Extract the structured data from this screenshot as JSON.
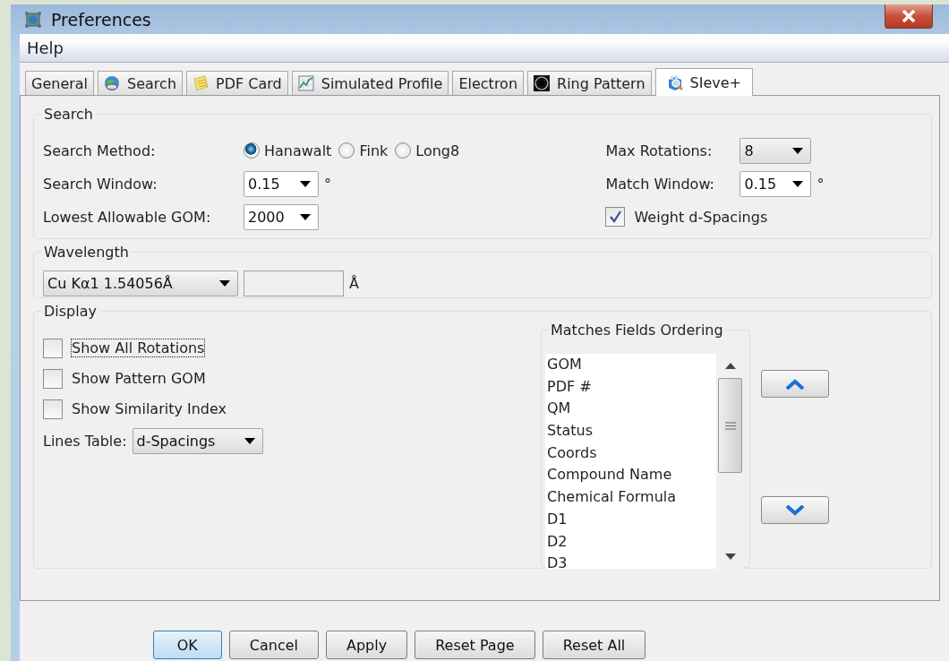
{
  "window": {
    "title": "Preferences"
  },
  "menu": [
    {
      "label": "Help"
    }
  ],
  "tabs": [
    {
      "label": "General",
      "selected": false
    },
    {
      "label": "Search",
      "selected": false
    },
    {
      "label": "PDF Card",
      "selected": false
    },
    {
      "label": "Simulated Profile",
      "selected": false
    },
    {
      "label": "Electron",
      "selected": false
    },
    {
      "label": "Ring Pattern",
      "selected": false
    },
    {
      "label": "SIeve+",
      "selected": true
    }
  ],
  "search": {
    "title": "Search",
    "method": {
      "label": "Search Method:",
      "options": [
        {
          "label": "Hanawalt",
          "selected": true
        },
        {
          "label": "Fink",
          "selected": false
        },
        {
          "label": "Long8",
          "selected": false
        }
      ]
    },
    "search_window": {
      "label": "Search Window:",
      "value": "0.15",
      "editable": true,
      "unit": "°"
    },
    "lowest_gom": {
      "label": "Lowest Allowable GOM:",
      "value": "2000",
      "editable": true
    },
    "max_rotations": {
      "label": "Max Rotations:",
      "value": "8",
      "editable": false
    },
    "match_window": {
      "label": "Match Window:",
      "value": "0.15",
      "editable": true,
      "unit": "°"
    },
    "weight": {
      "label": "Weight d-Spacings",
      "checked": true
    }
  },
  "wavelength": {
    "title": "Wavelength",
    "source": {
      "value": "Cu Kα1 1.54056Å",
      "editable": false
    },
    "custom": {
      "disabled": true,
      "unit": "Å"
    }
  },
  "display": {
    "title": "Display",
    "checkboxes": [
      {
        "label": "Show All Rotations",
        "checked": false,
        "focused": true
      },
      {
        "label": "Show Pattern GOM",
        "checked": false,
        "focused": false
      },
      {
        "label": "Show Similarity Index",
        "checked": false,
        "focused": false
      }
    ],
    "lines_table": {
      "label": "Lines Table:",
      "value": "d-Spacings",
      "editable": false
    },
    "ordering": {
      "title": "Matches Fields Ordering",
      "items": [
        "GOM",
        "PDF #",
        "QM",
        "Status",
        "Coords",
        "Compound Name",
        "Chemical Formula",
        "D1",
        "D2",
        "D3"
      ]
    }
  },
  "buttons": [
    {
      "label": "OK",
      "default": true
    },
    {
      "label": "Cancel",
      "default": false
    },
    {
      "label": "Apply",
      "default": false
    },
    {
      "label": "Reset Page",
      "default": false
    },
    {
      "label": "Reset All",
      "default": false
    }
  ]
}
